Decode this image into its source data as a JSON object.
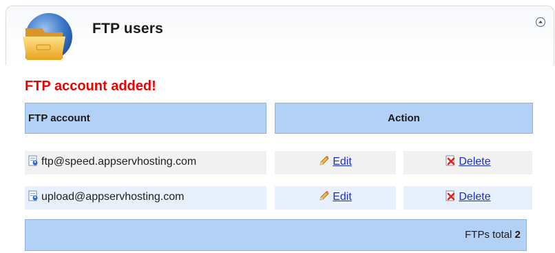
{
  "panel": {
    "title": "FTP users",
    "header_icon": "folder-icon",
    "collapse_icon": "collapse-up-icon"
  },
  "message": {
    "text": "FTP account added!",
    "color": "#ee0000"
  },
  "table": {
    "headers": {
      "account": "FTP account",
      "action": "Action"
    },
    "rows": [
      {
        "account": "ftp@speed.appservhosting.com",
        "edit": "Edit",
        "delete": "Delete"
      },
      {
        "account": "upload@appservhosting.com",
        "edit": "Edit",
        "delete": "Delete"
      }
    ],
    "account_icon": "ftp-user-icon",
    "edit_icon": "pencil-icon",
    "delete_icon": "delete-x-icon"
  },
  "footer": {
    "label": "FTPs total",
    "count": "2"
  },
  "colors": {
    "header_fill": "#b3d1f5",
    "link": "#1a2fc9",
    "row_alt": "#e7f0fb"
  }
}
